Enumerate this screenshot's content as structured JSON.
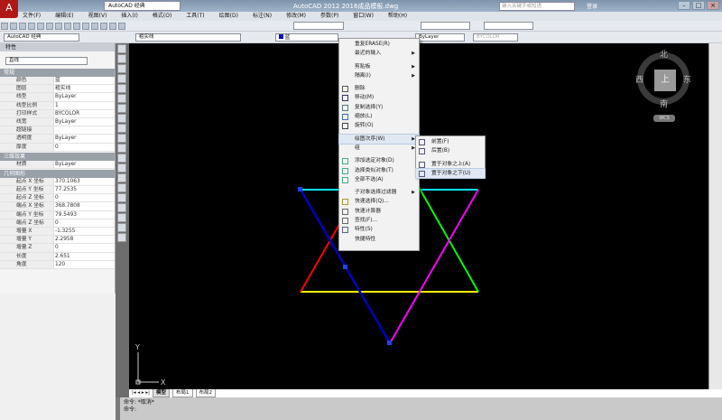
{
  "app": {
    "workspace": "AutoCAD 经典",
    "title": "AutoCAD 2012    2016成品模板.dwg",
    "search_placeholder": "键入关键字或短语",
    "login": "登录"
  },
  "menubar": [
    "文件(F)",
    "编辑(E)",
    "视图(V)",
    "插入(I)",
    "格式(O)",
    "工具(T)",
    "绘图(D)",
    "标注(N)",
    "修改(M)",
    "参数(P)",
    "窗口(W)",
    "帮助(H)"
  ],
  "toolbar": {
    "workspace_combo": "AutoCAD 经典",
    "layer": "粗实线",
    "color": "蓝",
    "linetype": "ByLayer",
    "lineweight": "ByLayer",
    "plotstyle": "BYCOLOR"
  },
  "properties": {
    "title": "特性",
    "object_type": "直线",
    "sections": [
      {
        "name": "常规",
        "rows": [
          [
            "颜色",
            "蓝"
          ],
          [
            "图层",
            "粗实线"
          ],
          [
            "线型",
            "ByLayer"
          ],
          [
            "线型比例",
            "1"
          ],
          [
            "打印样式",
            "BYCOLOR"
          ],
          [
            "线宽",
            "ByLayer"
          ],
          [
            "超链接",
            ""
          ],
          [
            "透明度",
            "ByLayer"
          ],
          [
            "厚度",
            "0"
          ]
        ]
      },
      {
        "name": "三维效果",
        "rows": [
          [
            "材质",
            "ByLayer"
          ]
        ]
      },
      {
        "name": "几何图形",
        "rows": [
          [
            "起点 X 坐标",
            "370.1063"
          ],
          [
            "起点 Y 坐标",
            "77.2535"
          ],
          [
            "起点 Z 坐标",
            "0"
          ],
          [
            "端点 X 坐标",
            "368.7808"
          ],
          [
            "端点 Y 坐标",
            "79.5493"
          ],
          [
            "端点 Z 坐标",
            "0"
          ],
          [
            "增量 X",
            "-1.3255"
          ],
          [
            "增量 Y",
            "2.2958"
          ],
          [
            "增量 Z",
            "0"
          ],
          [
            "长度",
            "2.651"
          ],
          [
            "角度",
            "120"
          ]
        ]
      }
    ]
  },
  "context_menu": [
    "重复ERASE(R)",
    "最近的输入",
    "剪贴板",
    "隔离(I)",
    "删除",
    "移动(M)",
    "复制选择(Y)",
    "缩放(L)",
    "旋转(O)",
    "绘图次序(W)",
    "组",
    "添加选定对象(D)",
    "选择类似对象(T)",
    "全部不选(A)",
    "子对象选择过滤器",
    "快速选择(Q)...",
    "快速计算器",
    "查找(F)...",
    "特性(S)",
    "快捷特性"
  ],
  "submenu": [
    "前置(F)",
    "后置(B)",
    "置于对象之上(A)",
    "置于对象之下(U)"
  ],
  "viewcube": {
    "north": "北",
    "south": "南",
    "east": "东",
    "west": "西",
    "face": "上",
    "wcs": "WCS"
  },
  "ucs": {
    "x": "X",
    "y": "Y"
  },
  "tabs": [
    "模型",
    "布局1",
    "布局2"
  ],
  "command": [
    "命令: *取消*",
    "命令:"
  ],
  "colors": {
    "selected_line": "#0000c0",
    "cyan": "#00e5ff",
    "yellow": "#ffff00",
    "red": "#ff0000",
    "green": "#00ff00",
    "magenta": "#ff00ff"
  }
}
